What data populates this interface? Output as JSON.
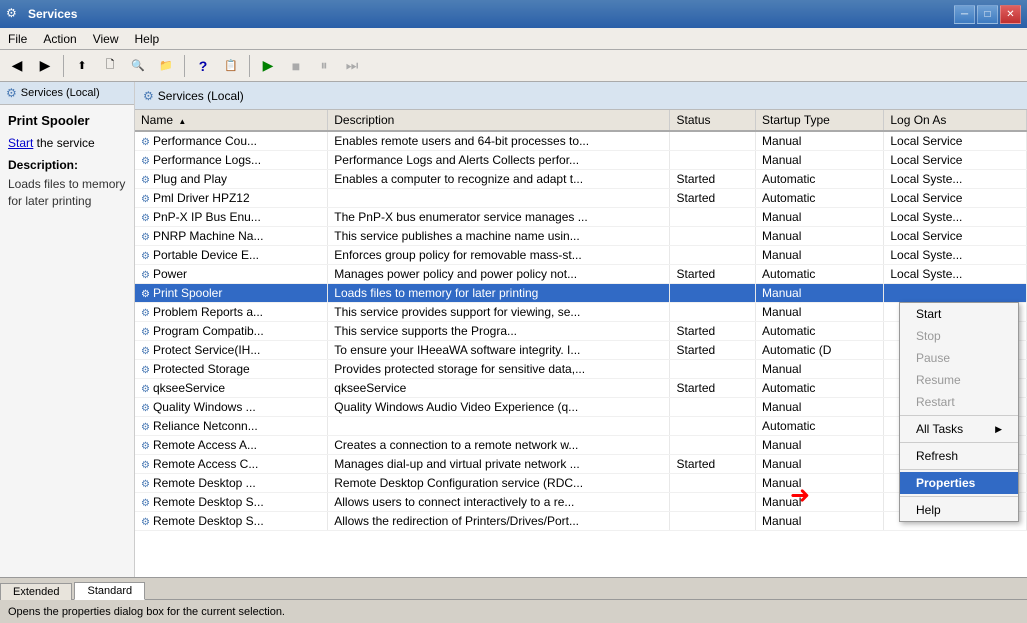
{
  "window": {
    "title": "Services",
    "icon": "⚙"
  },
  "titlebar": {
    "minimize": "─",
    "restore": "□",
    "close": "✕"
  },
  "menubar": {
    "items": [
      "File",
      "Action",
      "View",
      "Help"
    ]
  },
  "header": {
    "left_label": "Services (Local)",
    "right_label": "Services (Local)"
  },
  "left_panel": {
    "service_name": "Print Spooler",
    "link_text": "Start",
    "link_suffix": " the service",
    "description_label": "Description:",
    "description": "Loads files to memory for later printing"
  },
  "columns": {
    "name": "Name",
    "description": "Description",
    "status": "Status",
    "startup_type": "Startup Type",
    "log_on_as": "Log On As"
  },
  "services": [
    {
      "name": "Performance Cou...",
      "desc": "Enables remote users and 64-bit processes to...",
      "status": "",
      "startup": "Manual",
      "logon": "Local Service"
    },
    {
      "name": "Performance Logs...",
      "desc": "Performance Logs and Alerts Collects perfor...",
      "status": "",
      "startup": "Manual",
      "logon": "Local Service"
    },
    {
      "name": "Plug and Play",
      "desc": "Enables a computer to recognize and adapt t...",
      "status": "Started",
      "startup": "Automatic",
      "logon": "Local Syste..."
    },
    {
      "name": "Pml Driver HPZ12",
      "desc": "",
      "status": "Started",
      "startup": "Automatic",
      "logon": "Local Service"
    },
    {
      "name": "PnP-X IP Bus Enu...",
      "desc": "The PnP-X bus enumerator service manages ...",
      "status": "",
      "startup": "Manual",
      "logon": "Local Syste..."
    },
    {
      "name": "PNRP Machine Na...",
      "desc": "This service publishes a machine name usin...",
      "status": "",
      "startup": "Manual",
      "logon": "Local Service"
    },
    {
      "name": "Portable Device E...",
      "desc": "Enforces group policy for removable mass-st...",
      "status": "",
      "startup": "Manual",
      "logon": "Local Syste..."
    },
    {
      "name": "Power",
      "desc": "Manages power policy and power policy not...",
      "status": "Started",
      "startup": "Automatic",
      "logon": "Local Syste..."
    },
    {
      "name": "Print Spooler",
      "desc": "Loads files to memory for later printing",
      "status": "",
      "startup": "Manual",
      "logon": ""
    },
    {
      "name": "Problem Reports a...",
      "desc": "This service provides support for viewing, se...",
      "status": "",
      "startup": "Manual",
      "logon": ""
    },
    {
      "name": "Program Compatib...",
      "desc": "This service supports the Progra...",
      "status": "Started",
      "startup": "Automatic",
      "logon": ""
    },
    {
      "name": "Protect Service(IH...",
      "desc": "To ensure your IHeeaWA software integrity. I...",
      "status": "Started",
      "startup": "Automatic (D",
      "logon": ""
    },
    {
      "name": "Protected Storage",
      "desc": "Provides protected storage for sensitive data,...",
      "status": "",
      "startup": "Manual",
      "logon": ""
    },
    {
      "name": "qkseeService",
      "desc": "qkseeService",
      "status": "Started",
      "startup": "Automatic",
      "logon": ""
    },
    {
      "name": "Quality Windows ...",
      "desc": "Quality Windows Audio Video Experience (q...",
      "status": "",
      "startup": "Manual",
      "logon": ""
    },
    {
      "name": "Reliance Netconn...",
      "desc": "",
      "status": "",
      "startup": "Automatic",
      "logon": ""
    },
    {
      "name": "Remote Access A...",
      "desc": "Creates a connection to a remote network w...",
      "status": "",
      "startup": "Manual",
      "logon": ""
    },
    {
      "name": "Remote Access C...",
      "desc": "Manages dial-up and virtual private network ...",
      "status": "Started",
      "startup": "Manual",
      "logon": ""
    },
    {
      "name": "Remote Desktop ...",
      "desc": "Remote Desktop Configuration service (RDC...",
      "status": "",
      "startup": "Manual",
      "logon": ""
    },
    {
      "name": "Remote Desktop S...",
      "desc": "Allows users to connect interactively to a re...",
      "status": "",
      "startup": "Manual",
      "logon": ""
    },
    {
      "name": "Remote Desktop S...",
      "desc": "Allows the redirection of Printers/Drives/Port...",
      "status": "",
      "startup": "Manual",
      "logon": ""
    }
  ],
  "context_menu": {
    "items": [
      {
        "label": "Start",
        "enabled": true
      },
      {
        "label": "Stop",
        "enabled": false
      },
      {
        "label": "Pause",
        "enabled": false
      },
      {
        "label": "Resume",
        "enabled": false
      },
      {
        "label": "Restart",
        "enabled": false
      },
      {
        "sep": true
      },
      {
        "label": "All Tasks",
        "enabled": true,
        "arrow": true
      },
      {
        "sep": true
      },
      {
        "label": "Refresh",
        "enabled": true
      },
      {
        "sep": true
      },
      {
        "label": "Properties",
        "enabled": true,
        "highlighted": true
      },
      {
        "sep": true
      },
      {
        "label": "Help",
        "enabled": true
      }
    ]
  },
  "tabs": [
    {
      "label": "Extended",
      "active": false
    },
    {
      "label": "Standard",
      "active": true
    }
  ],
  "status_bar": {
    "text": "Opens the properties dialog box for the current selection."
  }
}
